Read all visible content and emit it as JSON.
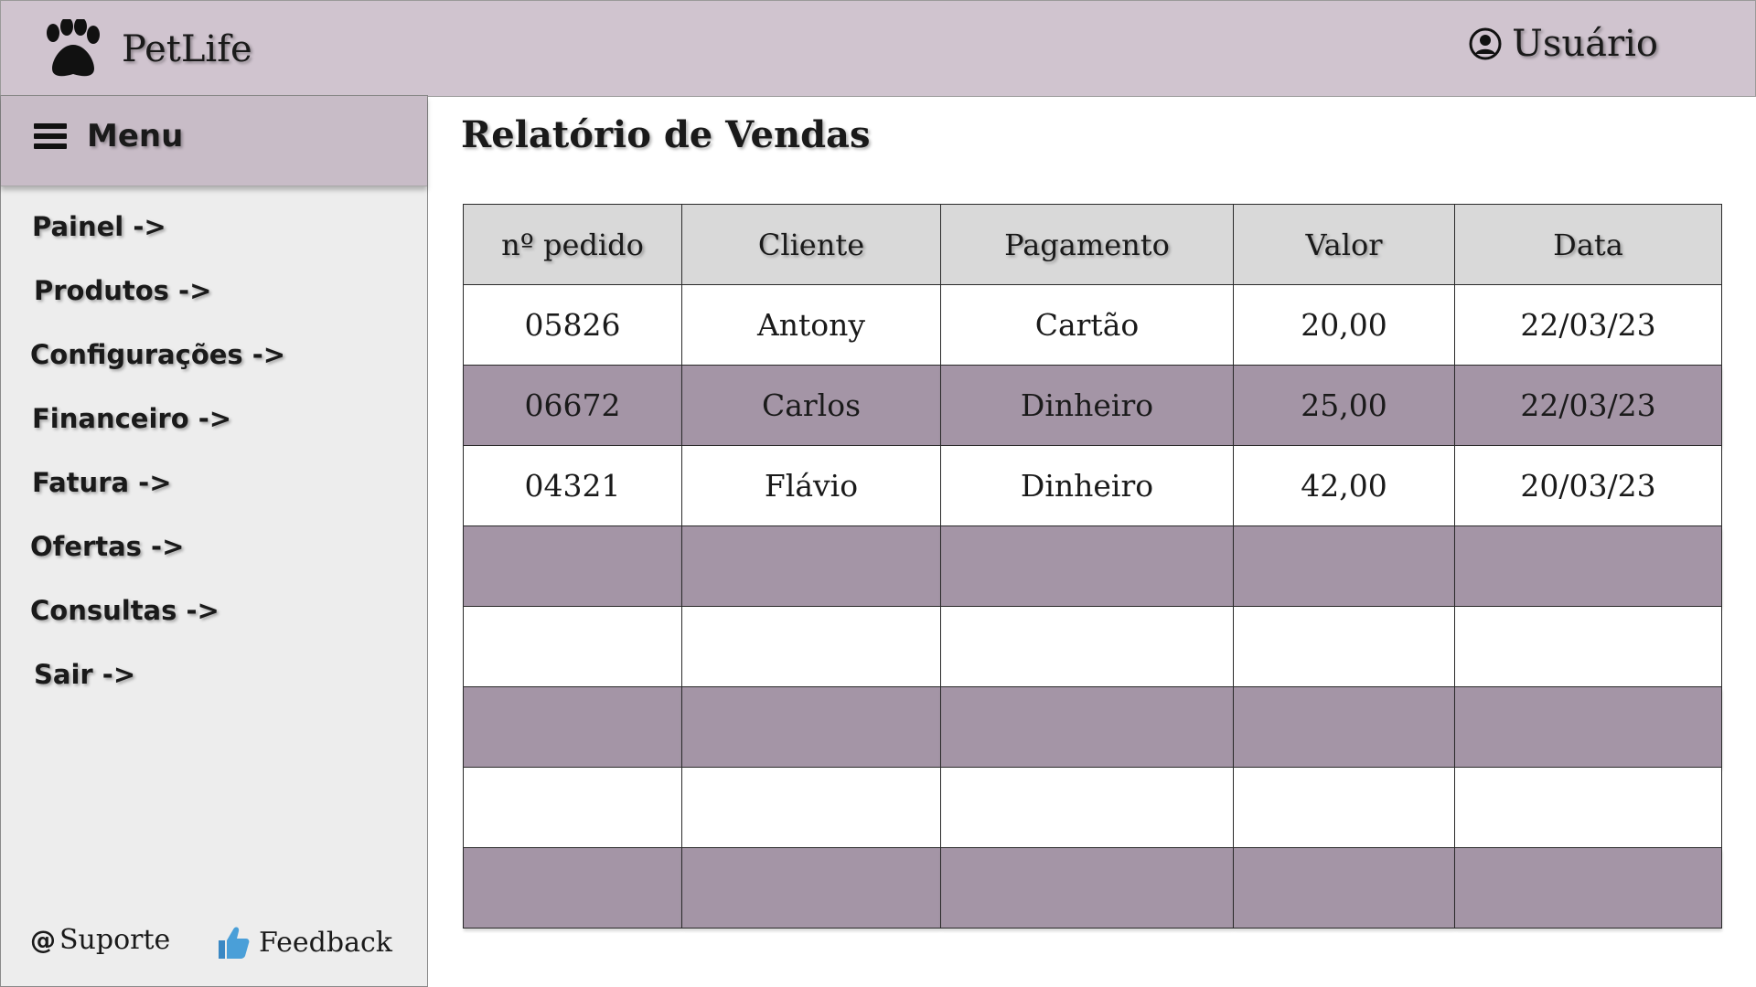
{
  "header": {
    "brand_name": "PetLife",
    "user_label": "Usuário"
  },
  "sidebar": {
    "menu_title": "Menu",
    "items": [
      {
        "label": "Painel ->"
      },
      {
        "label": "Produtos ->"
      },
      {
        "label": "Configurações ->"
      },
      {
        "label": "Financeiro ->"
      },
      {
        "label": "Fatura ->"
      },
      {
        "label": "Ofertas ->"
      },
      {
        "label": "Consultas ->"
      },
      {
        "label": "Sair ->"
      }
    ],
    "support_label": "Suporte",
    "feedback_label": "Feedback"
  },
  "main": {
    "title": "Relatório de Vendas",
    "table": {
      "columns": [
        "nº pedido",
        "Cliente",
        "Pagamento",
        "Valor",
        "Data"
      ],
      "rows": [
        [
          "05826",
          "Antony",
          "Cartão",
          "20,00",
          "22/03/23"
        ],
        [
          "06672",
          "Carlos",
          "Dinheiro",
          "25,00",
          "22/03/23"
        ],
        [
          "04321",
          "Flávio",
          "Dinheiro",
          "42,00",
          "20/03/23"
        ],
        [
          "",
          "",
          "",
          "",
          ""
        ],
        [
          "",
          "",
          "",
          "",
          ""
        ],
        [
          "",
          "",
          "",
          "",
          ""
        ],
        [
          "",
          "",
          "",
          "",
          ""
        ],
        [
          "",
          "",
          "",
          "",
          ""
        ]
      ]
    }
  },
  "colors": {
    "header_bg": "#d0c4cf",
    "menu_header_bg": "#c8bcc7",
    "sidebar_bg": "#ededed",
    "row_shaded": "#a495a6",
    "table_header_bg": "#d9d9d9",
    "thumb_blue": "#4a9fd8"
  },
  "icons": {
    "brand": "paw-icon",
    "user": "user-circle-icon",
    "menu": "hamburger-icon",
    "support": "at-icon",
    "feedback": "thumbs-up-icon"
  }
}
